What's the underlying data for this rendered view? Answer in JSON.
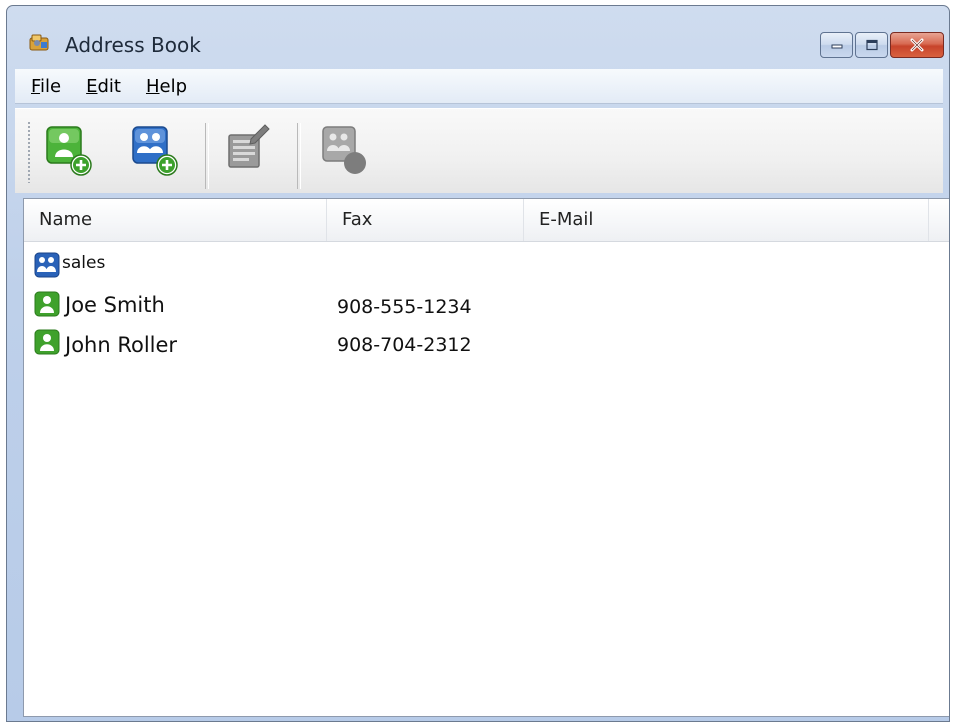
{
  "window": {
    "title": "Address Book",
    "controls": [
      "minimize",
      "maximize",
      "close"
    ]
  },
  "menu": [
    {
      "label": "File",
      "accelerator": "F"
    },
    {
      "label": "Edit",
      "accelerator": "E"
    },
    {
      "label": "Help",
      "accelerator": "H"
    }
  ],
  "toolbar": {
    "buttons": [
      {
        "icon": "new-contact-icon",
        "enabled": true
      },
      {
        "icon": "new-group-icon",
        "enabled": true
      },
      {
        "icon": "edit-icon",
        "enabled": false
      },
      {
        "icon": "delete-icon",
        "enabled": false
      }
    ]
  },
  "columns": [
    "Name",
    "Fax",
    "E-Mail"
  ],
  "rows": [
    {
      "type": "group",
      "name": "sales",
      "fax": "",
      "email": ""
    },
    {
      "type": "contact",
      "name": "Joe Smith",
      "fax": "908-555-1234",
      "email": ""
    },
    {
      "type": "contact",
      "name": "John Roller",
      "fax": "908-704-2312",
      "email": ""
    }
  ],
  "colors": {
    "contact_green": "#3fa12c",
    "group_blue": "#2a62b8",
    "disabled_gray": "#8a8a8a",
    "close_red": "#c7442b"
  }
}
